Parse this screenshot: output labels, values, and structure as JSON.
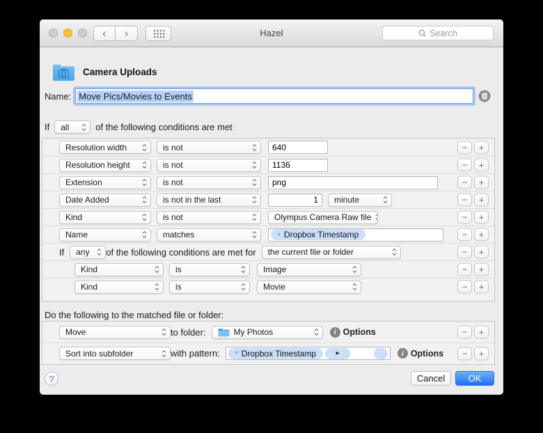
{
  "titlebar": {
    "title": "Hazel",
    "search_placeholder": "Search"
  },
  "icons": {
    "back_chevron": "‹",
    "forward_chevron": "›",
    "minus": "−",
    "plus": "+",
    "token_dot": "◦",
    "token_arrow": "▸",
    "info": "i",
    "help": "?"
  },
  "rule": {
    "title": "Camera Uploads",
    "name_label": "Name:",
    "name_value": "Move Pics/Movies to Events"
  },
  "conditions_header": {
    "if_label": "If",
    "match": "all",
    "rest": "of the following conditions are met"
  },
  "conditions": [
    {
      "attribute": "Resolution width",
      "operator": "is not",
      "value": "640"
    },
    {
      "attribute": "Resolution height",
      "operator": "is not",
      "value": "1136"
    },
    {
      "attribute": "Extension",
      "operator": "is not",
      "value": "png"
    },
    {
      "attribute": "Date Added",
      "operator": "is not in the last",
      "value": "1",
      "unit": "minute"
    },
    {
      "attribute": "Kind",
      "operator": "is not",
      "value": "Olympus Camera Raw file"
    },
    {
      "attribute": "Name",
      "operator": "matches",
      "token": "Dropbox Timestamp"
    }
  ],
  "nested": {
    "if_label": "If",
    "match": "any",
    "rest": "of the following conditions are met for",
    "scope": "the current file or folder",
    "rows": [
      {
        "attribute": "Kind",
        "operator": "is",
        "value": "Image"
      },
      {
        "attribute": "Kind",
        "operator": "is",
        "value": "Movie"
      }
    ]
  },
  "actions_header": "Do the following to the matched file or folder:",
  "actions": {
    "move": {
      "verb": "Move",
      "connector": "to folder:",
      "folder": "My Photos",
      "options": "Options"
    },
    "sort": {
      "verb": "Sort into subfolder",
      "connector": "with pattern:",
      "token": "Dropbox Timestamp",
      "options": "Options"
    }
  },
  "footer": {
    "cancel": "Cancel",
    "ok": "OK"
  }
}
